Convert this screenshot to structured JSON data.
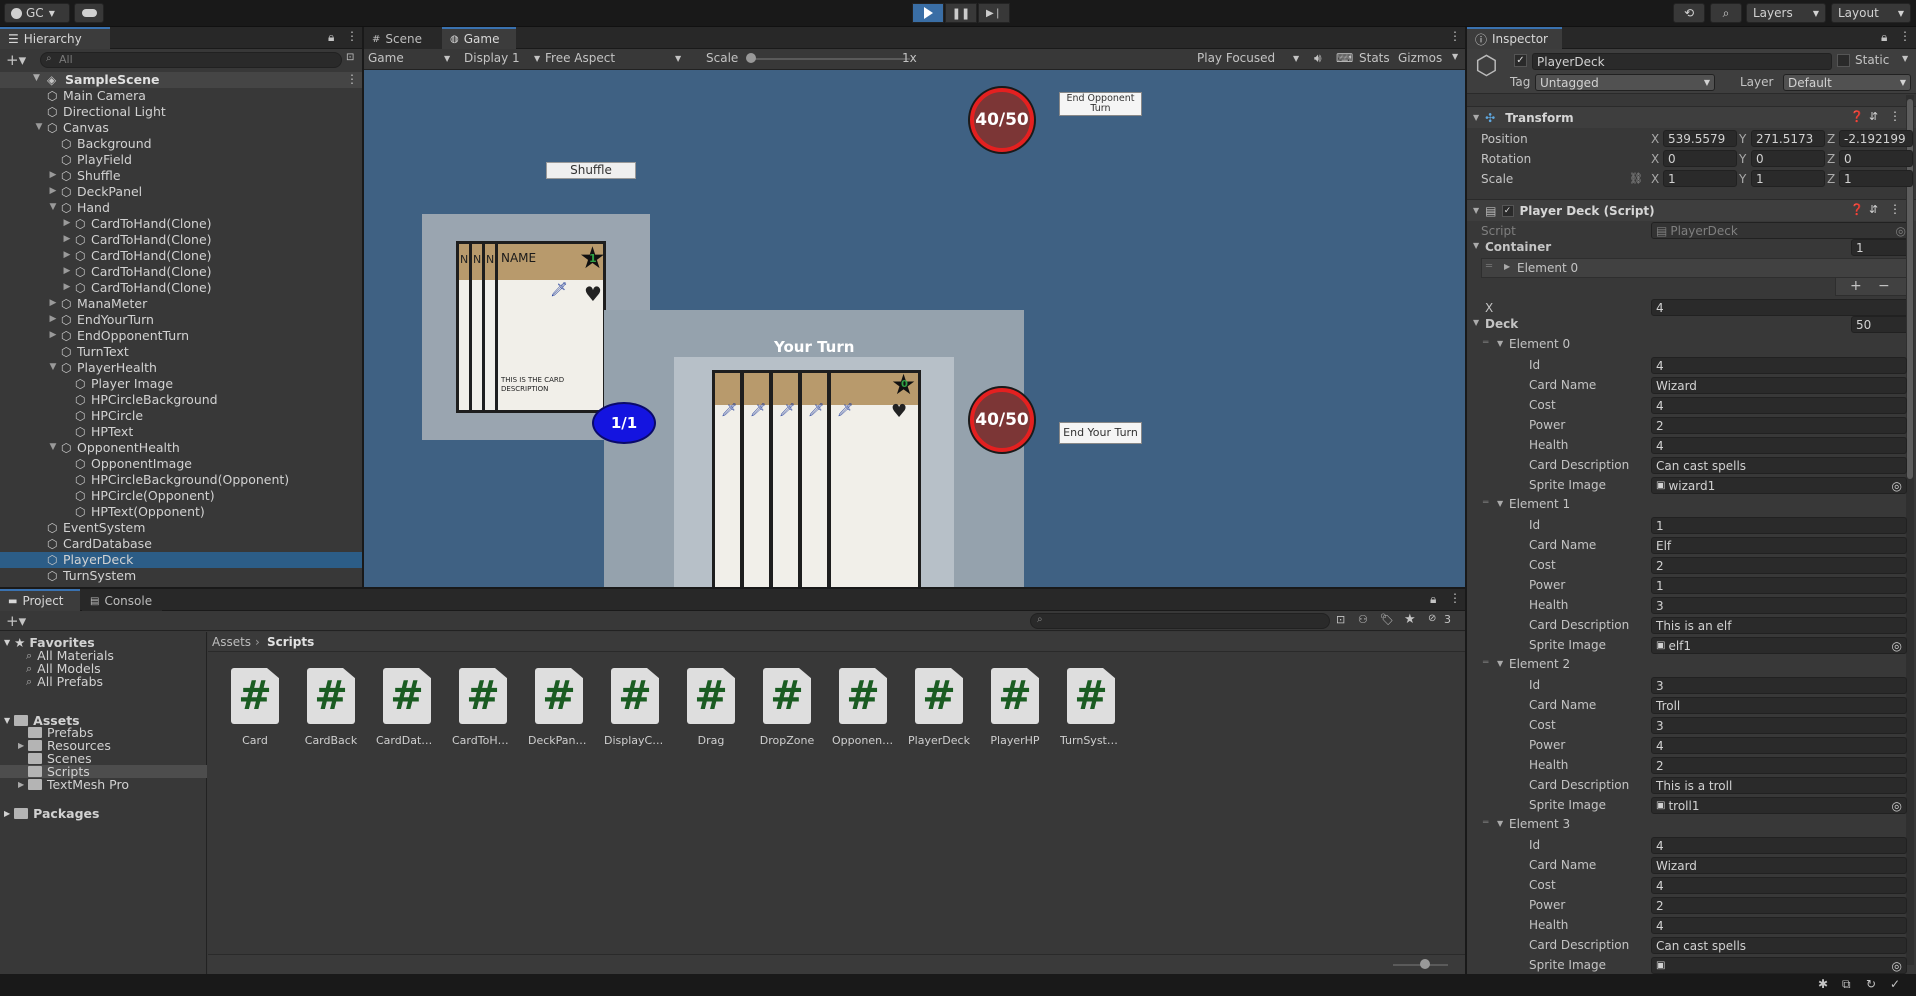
{
  "toolbar": {
    "account": "GC",
    "layers": "Layers",
    "layout": "Layout"
  },
  "hierarchy": {
    "tab": "Hierarchy",
    "search_placeholder": "All",
    "scene": "SampleScene",
    "items": [
      {
        "label": "Main Camera",
        "depth": 1,
        "arrow": ""
      },
      {
        "label": "Directional Light",
        "depth": 1,
        "arrow": ""
      },
      {
        "label": "Canvas",
        "depth": 1,
        "arrow": "down"
      },
      {
        "label": "Background",
        "depth": 2,
        "arrow": ""
      },
      {
        "label": "PlayField",
        "depth": 2,
        "arrow": ""
      },
      {
        "label": "Shuffle",
        "depth": 2,
        "arrow": "right"
      },
      {
        "label": "DeckPanel",
        "depth": 2,
        "arrow": "right"
      },
      {
        "label": "Hand",
        "depth": 2,
        "arrow": "down"
      },
      {
        "label": "CardToHand(Clone)",
        "depth": 3,
        "arrow": "right"
      },
      {
        "label": "CardToHand(Clone)",
        "depth": 3,
        "arrow": "right"
      },
      {
        "label": "CardToHand(Clone)",
        "depth": 3,
        "arrow": "right"
      },
      {
        "label": "CardToHand(Clone)",
        "depth": 3,
        "arrow": "right"
      },
      {
        "label": "CardToHand(Clone)",
        "depth": 3,
        "arrow": "right"
      },
      {
        "label": "ManaMeter",
        "depth": 2,
        "arrow": "right"
      },
      {
        "label": "EndYourTurn",
        "depth": 2,
        "arrow": "right"
      },
      {
        "label": "EndOpponentTurn",
        "depth": 2,
        "arrow": "right"
      },
      {
        "label": "TurnText",
        "depth": 2,
        "arrow": ""
      },
      {
        "label": "PlayerHealth",
        "depth": 2,
        "arrow": "down"
      },
      {
        "label": "Player Image",
        "depth": 3,
        "arrow": ""
      },
      {
        "label": "HPCircleBackground",
        "depth": 3,
        "arrow": ""
      },
      {
        "label": "HPCircle",
        "depth": 3,
        "arrow": ""
      },
      {
        "label": "HPText",
        "depth": 3,
        "arrow": ""
      },
      {
        "label": "OpponentHealth",
        "depth": 2,
        "arrow": "down"
      },
      {
        "label": "OpponentImage",
        "depth": 3,
        "arrow": ""
      },
      {
        "label": "HPCircleBackground(Opponent)",
        "depth": 3,
        "arrow": ""
      },
      {
        "label": "HPCircle(Opponent)",
        "depth": 3,
        "arrow": ""
      },
      {
        "label": "HPText(Opponent)",
        "depth": 3,
        "arrow": ""
      },
      {
        "label": "EventSystem",
        "depth": 1,
        "arrow": ""
      },
      {
        "label": "CardDatabase",
        "depth": 1,
        "arrow": ""
      },
      {
        "label": "PlayerDeck",
        "depth": 1,
        "arrow": "",
        "selected": true
      },
      {
        "label": "TurnSystem",
        "depth": 1,
        "arrow": ""
      }
    ]
  },
  "gamepanel": {
    "tab_scene": "Scene",
    "tab_game": "Game",
    "game_dropdown": "Game",
    "display": "Display 1",
    "aspect": "Free Aspect",
    "scale_label": "Scale",
    "scale_value": "1x",
    "play_focused": "Play Focused",
    "stats": "Stats",
    "gizmos": "Gizmos"
  },
  "game": {
    "shuffle": "Shuffle",
    "end_opponent_turn": "End Opponent Turn",
    "end_your_turn": "End Your Turn",
    "your_turn": "Your Turn",
    "opponent_hp": "40/50",
    "player_hp": "40/50",
    "mana": "1/1",
    "deck_card_name": "NAME",
    "deck_card_cost": "1",
    "deck_card_desc": "THIS IS THE CARD DESCRIPTION",
    "deck_card_peek": "N",
    "deck_card_peek_desc": "TH DE",
    "hand_card_cost": "0"
  },
  "project": {
    "tab_project": "Project",
    "tab_console": "Console",
    "favorites": "Favorites",
    "fav_items": [
      "All Materials",
      "All Models",
      "All Prefabs"
    ],
    "assets": "Assets",
    "asset_folders": [
      "Prefabs",
      "Resources",
      "Scenes",
      "Scripts",
      "TextMesh Pro"
    ],
    "packages": "Packages",
    "breadcrumb_root": "Assets",
    "breadcrumb_current": "Scripts",
    "hidden_count": "3",
    "scripts": [
      "Card",
      "CardBack",
      "CardDatab...",
      "CardToHa...",
      "DeckPanel...",
      "DisplayCard",
      "Drag",
      "DropZone",
      "Opponent...",
      "PlayerDeck",
      "PlayerHP",
      "TurnSystem"
    ]
  },
  "inspector": {
    "tab": "Inspector",
    "object_name": "PlayerDeck",
    "static_label": "Static",
    "tag_label": "Tag",
    "tag_value": "Untagged",
    "layer_label": "Layer",
    "layer_value": "Default",
    "transform": {
      "title": "Transform",
      "position_label": "Position",
      "rotation_label": "Rotation",
      "scale_label": "Scale",
      "position": [
        "539.5579",
        "271.5173",
        "-2.192199"
      ],
      "rotation": [
        "0",
        "0",
        "0"
      ],
      "scale": [
        "1",
        "1",
        "1"
      ]
    },
    "script_component": {
      "title": "Player Deck (Script)",
      "script_label": "Script",
      "script_value": "PlayerDeck",
      "container_label": "Container",
      "container_count": "1",
      "container_element": "Element 0",
      "x_label": "X",
      "x_value": "4",
      "deck_label": "Deck",
      "deck_count": "50"
    },
    "field_labels": [
      "Id",
      "Card Name",
      "Cost",
      "Power",
      "Health",
      "Card Description",
      "Sprite Image"
    ],
    "elements": [
      {
        "label": "Element 0",
        "values": [
          "4",
          "Wizard",
          "4",
          "2",
          "4",
          "Can cast spells",
          "wizard1"
        ]
      },
      {
        "label": "Element 1",
        "values": [
          "1",
          "Elf",
          "2",
          "1",
          "3",
          "This is an elf",
          "elf1"
        ]
      },
      {
        "label": "Element 2",
        "values": [
          "3",
          "Troll",
          "3",
          "4",
          "2",
          "This is a troll",
          "troll1"
        ]
      },
      {
        "label": "Element 3",
        "values": [
          "4",
          "Wizard",
          "4",
          "2",
          "4",
          "Can cast spells",
          ""
        ]
      }
    ]
  }
}
